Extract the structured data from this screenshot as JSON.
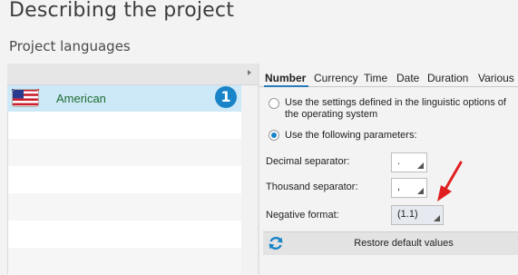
{
  "header": {
    "title": "Describing the project",
    "subtitle": "Project languages"
  },
  "languages": {
    "items": [
      {
        "name": "American",
        "badge": "1",
        "flag": "us-flag-icon",
        "selected": true
      }
    ]
  },
  "tabs": [
    {
      "label": "Number",
      "active": true
    },
    {
      "label": "Currency",
      "active": false
    },
    {
      "label": "Time",
      "active": false
    },
    {
      "label": "Date",
      "active": false
    },
    {
      "label": "Duration",
      "active": false
    },
    {
      "label": "Various",
      "active": false
    }
  ],
  "number_settings": {
    "option_os": "Use the settings defined in the linguistic options of the operating system",
    "option_os_line1": "Use the settings defined in the linguistic options of",
    "option_os_line2": "the operating system",
    "option_custom": "Use the following parameters:",
    "selected_option": "custom",
    "decimal_label": "Decimal separator:",
    "decimal_value": ".",
    "thousand_label": "Thousand separator:",
    "thousand_value": ",",
    "negative_label": "Negative format:",
    "negative_value": "(1.1)",
    "restore_label": "Restore default values"
  },
  "colors": {
    "accent": "#1a84c8",
    "selected_row": "#cde8f6",
    "language_text": "#1d6d33",
    "annotation_arrow": "#e02020"
  },
  "icons": {
    "restore": "refresh-icon",
    "annotation": "red-arrow-annotation"
  }
}
